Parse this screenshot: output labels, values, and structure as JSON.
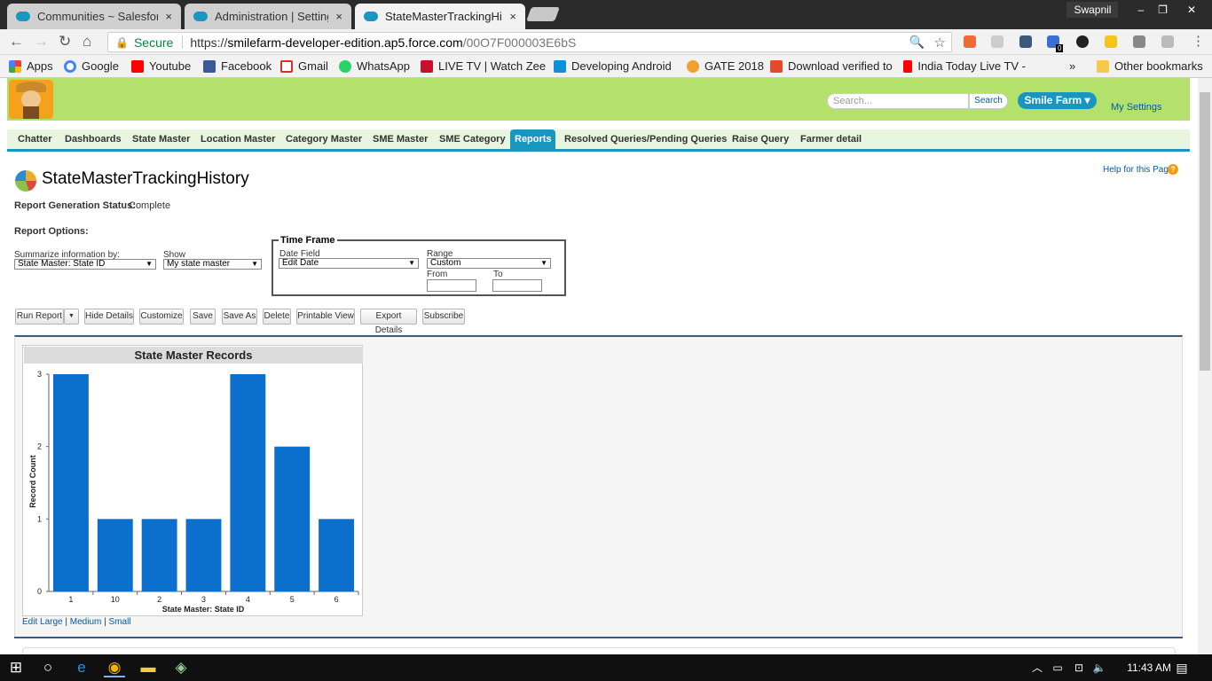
{
  "browser": {
    "tabs": [
      {
        "title": "Communities ~ Salesforc",
        "close": "×"
      },
      {
        "title": "Administration | Settings",
        "close": "×"
      },
      {
        "title": "StateMasterTrackingHisto",
        "close": "×"
      }
    ],
    "profile": "Swapnil",
    "win_min": "‒",
    "win_max": "❐",
    "win_close": "✕",
    "secure_label": "Secure",
    "url_scheme": "https://",
    "url_host": "smilefarm-developer-edition.ap5.force.com",
    "url_path": "/00O7F000003E6bS",
    "ext_badge": "0",
    "bookmarks": [
      {
        "label": "Apps",
        "color": "#e94235"
      },
      {
        "label": "Google",
        "color": "#4285f4"
      },
      {
        "label": "Youtube",
        "color": "#ff0000"
      },
      {
        "label": "Facebook",
        "color": "#3b5998"
      },
      {
        "label": "Gmail",
        "color": "#d93025"
      },
      {
        "label": "WhatsApp",
        "color": "#25d366"
      },
      {
        "label": "LIVE TV | Watch Zee",
        "color": "#c8102e"
      },
      {
        "label": "Developing Android",
        "color": "#0f8fd7"
      },
      {
        "label": "GATE 2018",
        "color": "#f0a030"
      },
      {
        "label": "Download verified to",
        "color": "#e34a2c"
      },
      {
        "label": "India Today Live TV -",
        "color": "#ff0000"
      }
    ],
    "more_bookmarks": "»",
    "other_bookmarks": "Other bookmarks"
  },
  "header": {
    "search_placeholder": "Search...",
    "search_button": "Search",
    "org_menu": "Smile Farm ▾",
    "my_settings": "My Settings"
  },
  "nav_tabs": [
    "Chatter",
    "Dashboards",
    "State Master",
    "Location Master",
    "Category Master",
    "SME Master",
    "SME Category",
    "Reports",
    "Resolved Queries/Pending Queries",
    "Raise Query",
    "Farmer detail"
  ],
  "active_tab": "Reports",
  "report": {
    "title": "StateMasterTrackingHistory",
    "help": "Help for this Page",
    "help_icon": "?",
    "status_label": "Report Generation Status:",
    "status_value": "Complete",
    "options_label": "Report Options:",
    "summarize_label": "Summarize information by:",
    "summarize_value": "State Master: State ID",
    "show_label": "Show",
    "show_value": "My state master",
    "time_frame_legend": "Time Frame",
    "date_field_label": "Date Field",
    "date_field_value": "Edit Date",
    "range_label": "Range",
    "range_value": "Custom",
    "from_label": "From",
    "to_label": "To",
    "from_value": "",
    "to_value": ""
  },
  "buttons": {
    "run_report": "Run Report",
    "run_report_arrow": "▼",
    "hide_details": "Hide Details",
    "customize": "Customize",
    "save": "Save",
    "save_as": "Save As",
    "delete": "Delete",
    "printable_view": "Printable View",
    "export_details": "Export Details",
    "subscribe": "Subscribe"
  },
  "chart_links": {
    "edit": "Edit",
    "large": "Large",
    "medium": "Medium",
    "small": "Small",
    "sep": "|"
  },
  "chart_data": {
    "type": "bar",
    "title": "State Master Records",
    "xlabel": "State Master: State ID",
    "ylabel": "Record Count",
    "categories": [
      "1",
      "10",
      "2",
      "3",
      "4",
      "5",
      "6"
    ],
    "values": [
      3,
      1,
      1,
      1,
      3,
      2,
      1
    ],
    "ylim": [
      0,
      3
    ],
    "yticks": [
      0,
      1,
      2,
      3
    ],
    "bar_color": "#0b6fce",
    "grid": false,
    "legend": "none"
  },
  "taskbar": {
    "time": "11:43 AM"
  }
}
